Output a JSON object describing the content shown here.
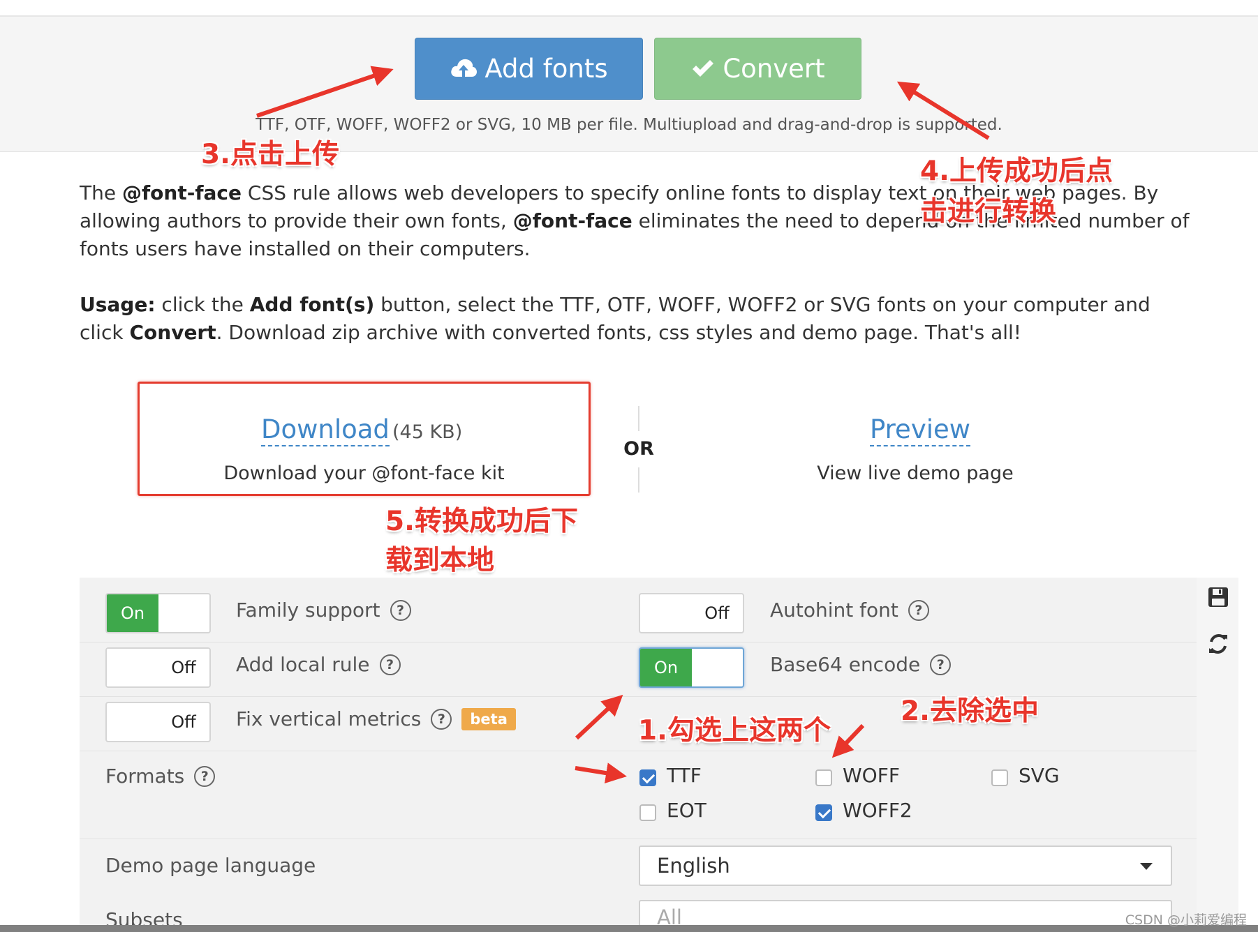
{
  "upload": {
    "add_fonts_label": "Add fonts",
    "convert_label": "Convert",
    "hint": "TTF, OTF, WOFF, WOFF2 or SVG, 10 MB per file. Multiupload and drag-and-drop is supported."
  },
  "intro": {
    "p1_a": "The ",
    "p1_b": "@font-face",
    "p1_c": " CSS rule allows web developers to specify online fonts to display text on their web pages. By allowing authors to provide their own fonts, ",
    "p1_d": "@font-face",
    "p1_e": " eliminates the need to depend on the limited number of fonts users have installed on their computers.",
    "usage_label": "Usage:",
    "usage_a": " click the ",
    "usage_b": "Add font(s)",
    "usage_c": " button, select the TTF, OTF, WOFF, WOFF2 or SVG fonts on your computer and click ",
    "usage_d": "Convert",
    "usage_e": ". Download zip archive with converted fonts, css styles and demo page. That's all!"
  },
  "result": {
    "download_label": "Download",
    "download_size": "(45 KB)",
    "download_sub": "Download your @font-face kit",
    "or_label": "OR",
    "preview_label": "Preview",
    "preview_sub": "View live demo page"
  },
  "options": {
    "family_support": {
      "label": "Family support",
      "state": "On"
    },
    "add_local_rule": {
      "label": "Add local rule",
      "state": "Off"
    },
    "fix_vertical_metrics": {
      "label": "Fix vertical metrics",
      "state": "Off",
      "badge": "beta"
    },
    "autohint_font": {
      "label": "Autohint font",
      "state": "Off"
    },
    "base64_encode": {
      "label": "Base64 encode",
      "state": "On"
    },
    "help_glyph": "?",
    "formats_label": "Formats",
    "formats": [
      {
        "name": "TTF",
        "checked": true
      },
      {
        "name": "WOFF",
        "checked": false
      },
      {
        "name": "SVG",
        "checked": false
      },
      {
        "name": "EOT",
        "checked": false
      },
      {
        "name": "WOFF2",
        "checked": true
      }
    ],
    "demo_language_label": "Demo page language",
    "demo_language_value": "English",
    "subsets_label": "Subsets",
    "subsets_value": "All"
  },
  "annotations": {
    "step1": "1.勾选上这两个",
    "step2": "2.去除选中",
    "step3": "3.点击上传",
    "step4_line1": "4.上传成功后点",
    "step4_line2": "击进行转换",
    "step5_line1": "5.转换成功后下",
    "step5_line2": "载到本地"
  },
  "watermark": "CSDN @小莉爱编程",
  "icons": {
    "add_fonts": "cloud-upload-icon",
    "convert": "checkmark-icon",
    "save": "save-icon",
    "refresh": "refresh-icon"
  },
  "colors": {
    "add_button": "#4f8fcb",
    "convert_button": "#8dc98e",
    "toggle_on": "#3ea84b",
    "link": "#3f86c7",
    "annotation": "#e8352b",
    "beta_badge": "#efa94a"
  }
}
